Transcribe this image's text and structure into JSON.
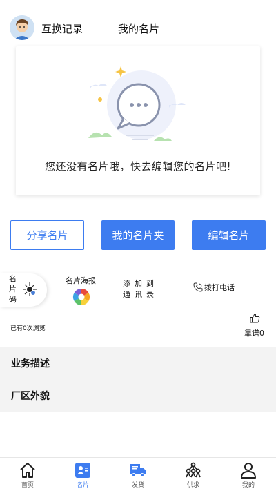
{
  "header": {
    "tabs": [
      {
        "label": "互换记录"
      },
      {
        "label": "我的名片"
      }
    ]
  },
  "empty_state": {
    "message": "您还没有名片哦，快去编辑您的名片吧!"
  },
  "actions": {
    "share_label": "分享名片",
    "folder_label": "我的名片夹",
    "edit_label": "编辑名片"
  },
  "tools": {
    "qr_label": "名片码",
    "poster_label": "名片海报",
    "contacts_label": "添加到通讯录",
    "call_label": "拨打电话"
  },
  "stats": {
    "views_text": "已有0次浏览",
    "like_text": "靠谱0"
  },
  "sections": [
    {
      "title": "业务描述"
    },
    {
      "title": "厂区外貌"
    }
  ],
  "tabbar": {
    "items": [
      {
        "label": "首页",
        "icon": "home-icon"
      },
      {
        "label": "名片",
        "icon": "card-icon",
        "active": true
      },
      {
        "label": "发货",
        "icon": "truck-icon"
      },
      {
        "label": "供求",
        "icon": "network-icon"
      },
      {
        "label": "我的",
        "icon": "user-icon"
      }
    ]
  },
  "colors": {
    "accent": "#3d7cf0",
    "section_bg": "#f3f3f3"
  }
}
